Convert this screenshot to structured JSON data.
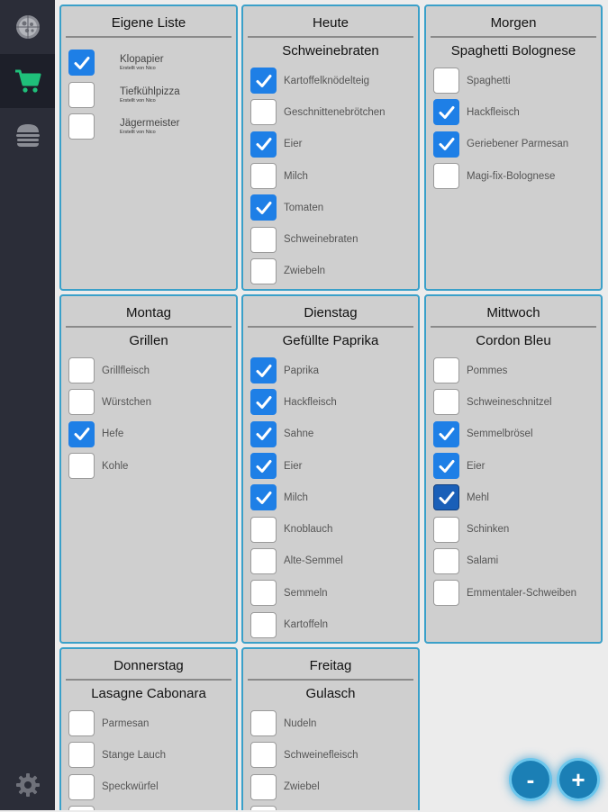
{
  "nav": {
    "items": [
      {
        "icon": "pizza-icon",
        "active": false
      },
      {
        "icon": "cart-icon",
        "active": true
      },
      {
        "icon": "burger-icon",
        "active": false
      }
    ],
    "settings_icon": "gear-icon"
  },
  "cards": [
    {
      "title": "Eigene Liste",
      "own": true,
      "items": [
        {
          "label": "Klopapier",
          "meta": "Erstellt von Nico",
          "checked": true
        },
        {
          "label": "Tiefkühlpizza",
          "meta": "Erstellt von Nico",
          "checked": false
        },
        {
          "label": "Jägermeister",
          "meta": "Erstellt von Nico",
          "checked": false
        }
      ]
    },
    {
      "title": "Heute",
      "dish": "Schweinebraten",
      "items": [
        {
          "label": "Kartoffelknödelteig",
          "checked": true
        },
        {
          "label": "Geschnittenebrötchen",
          "checked": false
        },
        {
          "label": "Eier",
          "checked": true
        },
        {
          "label": "Milch",
          "checked": false
        },
        {
          "label": "Tomaten",
          "checked": true
        },
        {
          "label": "Schweinebraten",
          "checked": false
        },
        {
          "label": "Zwiebeln",
          "checked": false
        }
      ]
    },
    {
      "title": "Morgen",
      "dish": "Spaghetti Bolognese",
      "items": [
        {
          "label": "Spaghetti",
          "checked": false
        },
        {
          "label": "Hackfleisch",
          "checked": true
        },
        {
          "label": "Geriebener Parmesan",
          "checked": true
        },
        {
          "label": "Magi-fix-Bolognese",
          "checked": false
        }
      ]
    },
    {
      "title": "Montag",
      "dish": "Grillen",
      "items": [
        {
          "label": "Grillfleisch",
          "checked": false
        },
        {
          "label": "Würstchen",
          "checked": false
        },
        {
          "label": "Hefe",
          "checked": true
        },
        {
          "label": "Kohle",
          "checked": false
        }
      ]
    },
    {
      "title": "Dienstag",
      "dish": "Gefüllte Paprika",
      "items": [
        {
          "label": "Paprika",
          "checked": true
        },
        {
          "label": "Hackfleisch",
          "checked": true
        },
        {
          "label": "Sahne",
          "checked": true
        },
        {
          "label": "Eier",
          "checked": true
        },
        {
          "label": "Milch",
          "checked": true
        },
        {
          "label": "Knoblauch",
          "checked": false
        },
        {
          "label": "Alte-Semmel",
          "checked": false
        },
        {
          "label": "Semmeln",
          "checked": false
        },
        {
          "label": "Kartoffeln",
          "checked": false
        }
      ]
    },
    {
      "title": "Mittwoch",
      "dish": "Cordon Bleu",
      "items": [
        {
          "label": "Pommes",
          "checked": false
        },
        {
          "label": "Schweineschnitzel",
          "checked": false
        },
        {
          "label": "Semmelbrösel",
          "checked": true
        },
        {
          "label": "Eier",
          "checked": true
        },
        {
          "label": "Mehl",
          "checked": true,
          "focused": true
        },
        {
          "label": "Schinken",
          "checked": false
        },
        {
          "label": "Salami",
          "checked": false
        },
        {
          "label": "Emmentaler-Schweiben",
          "checked": false
        }
      ]
    },
    {
      "title": "Donnerstag",
      "dish": "Lasagne Cabonara",
      "items": [
        {
          "label": "Parmesan",
          "checked": false
        },
        {
          "label": "Stange Lauch",
          "checked": false
        },
        {
          "label": "Speckwürfel",
          "checked": false
        },
        {
          "label": "",
          "checked": false
        }
      ]
    },
    {
      "title": "Freitag",
      "dish": "Gulasch",
      "items": [
        {
          "label": "Nudeln",
          "checked": false
        },
        {
          "label": "Schweinefleisch",
          "checked": false
        },
        {
          "label": "Zwiebel",
          "checked": false
        },
        {
          "label": "",
          "checked": false
        }
      ]
    }
  ],
  "fab": {
    "minus": "-",
    "plus": "+"
  },
  "colors": {
    "accent": "#3aa0c9",
    "checked": "#1e7fe6",
    "rail": "#2b2d38",
    "active_icon": "#1fc07a"
  }
}
